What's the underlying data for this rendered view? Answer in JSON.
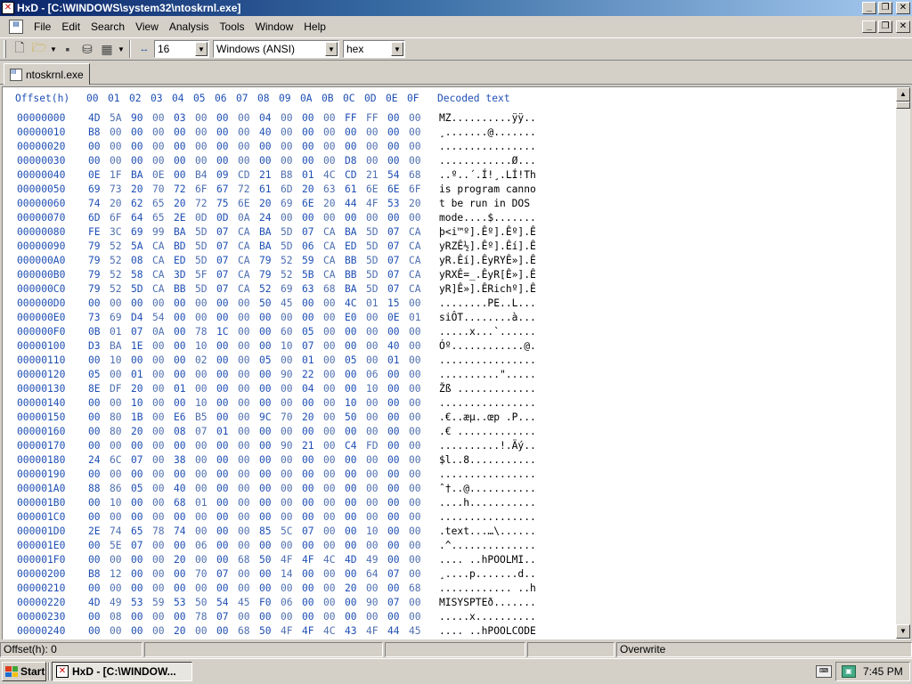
{
  "window": {
    "title": "HxD - [C:\\WINDOWS\\system32\\ntoskrnl.exe]"
  },
  "window_buttons": {
    "minimize": "_",
    "restore": "❐",
    "close": "✕"
  },
  "menu": [
    "File",
    "Edit",
    "Search",
    "View",
    "Analysis",
    "Tools",
    "Window",
    "Help"
  ],
  "toolbar": {
    "bytes_per_row": "16",
    "charset": "Windows (ANSI)",
    "offset_base": "hex"
  },
  "tab": {
    "label": "ntoskrnl.exe"
  },
  "hex": {
    "offset_header": "Offset(h)",
    "columns": [
      "00",
      "01",
      "02",
      "03",
      "04",
      "05",
      "06",
      "07",
      "08",
      "09",
      "0A",
      "0B",
      "0C",
      "0D",
      "0E",
      "0F"
    ],
    "decoded_header": "Decoded text",
    "rows": [
      {
        "offset": "00000000",
        "bytes": "4D 5A 90 00 03 00 00 00 04 00 00 00 FF FF 00 00",
        "text": "MZ..........ÿÿ.."
      },
      {
        "offset": "00000010",
        "bytes": "B8 00 00 00 00 00 00 00 40 00 00 00 00 00 00 00",
        "text": "¸.......@......."
      },
      {
        "offset": "00000020",
        "bytes": "00 00 00 00 00 00 00 00 00 00 00 00 00 00 00 00",
        "text": "................"
      },
      {
        "offset": "00000030",
        "bytes": "00 00 00 00 00 00 00 00 00 00 00 00 D8 00 00 00",
        "text": "............Ø..."
      },
      {
        "offset": "00000040",
        "bytes": "0E 1F BA 0E 00 B4 09 CD 21 B8 01 4C CD 21 54 68",
        "text": "..º..´.Í!¸.LÍ!Th"
      },
      {
        "offset": "00000050",
        "bytes": "69 73 20 70 72 6F 67 72 61 6D 20 63 61 6E 6E 6F",
        "text": "is program canno"
      },
      {
        "offset": "00000060",
        "bytes": "74 20 62 65 20 72 75 6E 20 69 6E 20 44 4F 53 20",
        "text": "t be run in DOS "
      },
      {
        "offset": "00000070",
        "bytes": "6D 6F 64 65 2E 0D 0D 0A 24 00 00 00 00 00 00 00",
        "text": "mode....$......."
      },
      {
        "offset": "00000080",
        "bytes": "FE 3C 69 99 BA 5D 07 CA BA 5D 07 CA BA 5D 07 CA",
        "text": "þ<i™º].Êº].Êº].Ê"
      },
      {
        "offset": "00000090",
        "bytes": "79 52 5A CA BD 5D 07 CA BA 5D 06 CA ED 5D 07 CA",
        "text": "yRZÊ½].Êº].Êí].Ê"
      },
      {
        "offset": "000000A0",
        "bytes": "79 52 08 CA ED 5D 07 CA 79 52 59 CA BB 5D 07 CA",
        "text": "yR.Êí].ÊyRYÊ»].Ê"
      },
      {
        "offset": "000000B0",
        "bytes": "79 52 58 CA 3D 5F 07 CA 79 52 5B CA BB 5D 07 CA",
        "text": "yRXÊ=_.ÊyR[Ê»].Ê"
      },
      {
        "offset": "000000C0",
        "bytes": "79 52 5D CA BB 5D 07 CA 52 69 63 68 BA 5D 07 CA",
        "text": "yR]Ê»].ÊRichº].Ê"
      },
      {
        "offset": "000000D0",
        "bytes": "00 00 00 00 00 00 00 00 50 45 00 00 4C 01 15 00",
        "text": "........PE..L..."
      },
      {
        "offset": "000000E0",
        "bytes": "73 69 D4 54 00 00 00 00 00 00 00 00 E0 00 0E 01",
        "text": "siÔT........à..."
      },
      {
        "offset": "000000F0",
        "bytes": "0B 01 07 0A 00 78 1C 00 00 60 05 00 00 00 00 00",
        "text": ".....x...`......"
      },
      {
        "offset": "00000100",
        "bytes": "D3 BA 1E 00 00 10 00 00 00 10 07 00 00 00 40 00",
        "text": "Óº............@."
      },
      {
        "offset": "00000110",
        "bytes": "00 10 00 00 00 02 00 00 05 00 01 00 05 00 01 00",
        "text": "................"
      },
      {
        "offset": "00000120",
        "bytes": "05 00 01 00 00 00 00 00 00 90 22 00 00 06 00 00",
        "text": "..........\"....."
      },
      {
        "offset": "00000130",
        "bytes": "8E DF 20 00 01 00 00 00 00 00 04 00 00 10 00 00",
        "text": "Žß ............."
      },
      {
        "offset": "00000140",
        "bytes": "00 00 10 00 00 10 00 00 00 00 00 00 10 00 00 00",
        "text": "................"
      },
      {
        "offset": "00000150",
        "bytes": "00 80 1B 00 E6 B5 00 00 9C 70 20 00 50 00 00 00",
        "text": ".€..æµ..œp .P..."
      },
      {
        "offset": "00000160",
        "bytes": "00 80 20 00 08 07 01 00 00 00 00 00 00 00 00 00",
        "text": ".€ ............."
      },
      {
        "offset": "00000170",
        "bytes": "00 00 00 00 00 00 00 00 00 90 21 00 C4 FD 00 00",
        "text": "..........!.Äý.."
      },
      {
        "offset": "00000180",
        "bytes": "24 6C 07 00 38 00 00 00 00 00 00 00 00 00 00 00",
        "text": "$l..8..........."
      },
      {
        "offset": "00000190",
        "bytes": "00 00 00 00 00 00 00 00 00 00 00 00 00 00 00 00",
        "text": "................"
      },
      {
        "offset": "000001A0",
        "bytes": "88 86 05 00 40 00 00 00 00 00 00 00 00 00 00 00",
        "text": "ˆ†..@..........."
      },
      {
        "offset": "000001B0",
        "bytes": "00 10 00 00 68 01 00 00 00 00 00 00 00 00 00 00",
        "text": "....h..........."
      },
      {
        "offset": "000001C0",
        "bytes": "00 00 00 00 00 00 00 00 00 00 00 00 00 00 00 00",
        "text": "................"
      },
      {
        "offset": "000001D0",
        "bytes": "2E 74 65 78 74 00 00 00 85 5C 07 00 00 10 00 00",
        "text": ".text...…\\......"
      },
      {
        "offset": "000001E0",
        "bytes": "00 5E 07 00 00 06 00 00 00 00 00 00 00 00 00 00",
        "text": ".^.............."
      },
      {
        "offset": "000001F0",
        "bytes": "00 00 00 00 20 00 00 68 50 4F 4F 4C 4D 49 00 00",
        "text": ".... ..hPOOLMI.."
      },
      {
        "offset": "00000200",
        "bytes": "B8 12 00 00 00 70 07 00 00 14 00 00 00 64 07 00",
        "text": "¸....p.......d.."
      },
      {
        "offset": "00000210",
        "bytes": "00 00 00 00 00 00 00 00 00 00 00 00 20 00 00 68",
        "text": "............ ..h"
      },
      {
        "offset": "00000220",
        "bytes": "4D 49 53 59 53 50 54 45 F0 06 00 00 00 90 07 00",
        "text": "MISYSPTEð......."
      },
      {
        "offset": "00000230",
        "bytes": "00 08 00 00 00 78 07 00 00 00 00 00 00 00 00 00",
        "text": ".....x.........."
      },
      {
        "offset": "00000240",
        "bytes": "00 00 00 00 20 00 00 68 50 4F 4F 4C 43 4F 44 45",
        "text": ".... ..hPOOLCODE"
      }
    ]
  },
  "status": {
    "offset": "Offset(h): 0",
    "mode": "Overwrite"
  },
  "taskbar": {
    "start_label": "Start",
    "task_label": "HxD - [C:\\WINDOW...",
    "clock": "7:45 PM"
  },
  "colors": {
    "title_start": "#0a246a",
    "title_end": "#a6caf0",
    "hex_text": "#1e4fb4",
    "face": "#d4d0c8"
  }
}
